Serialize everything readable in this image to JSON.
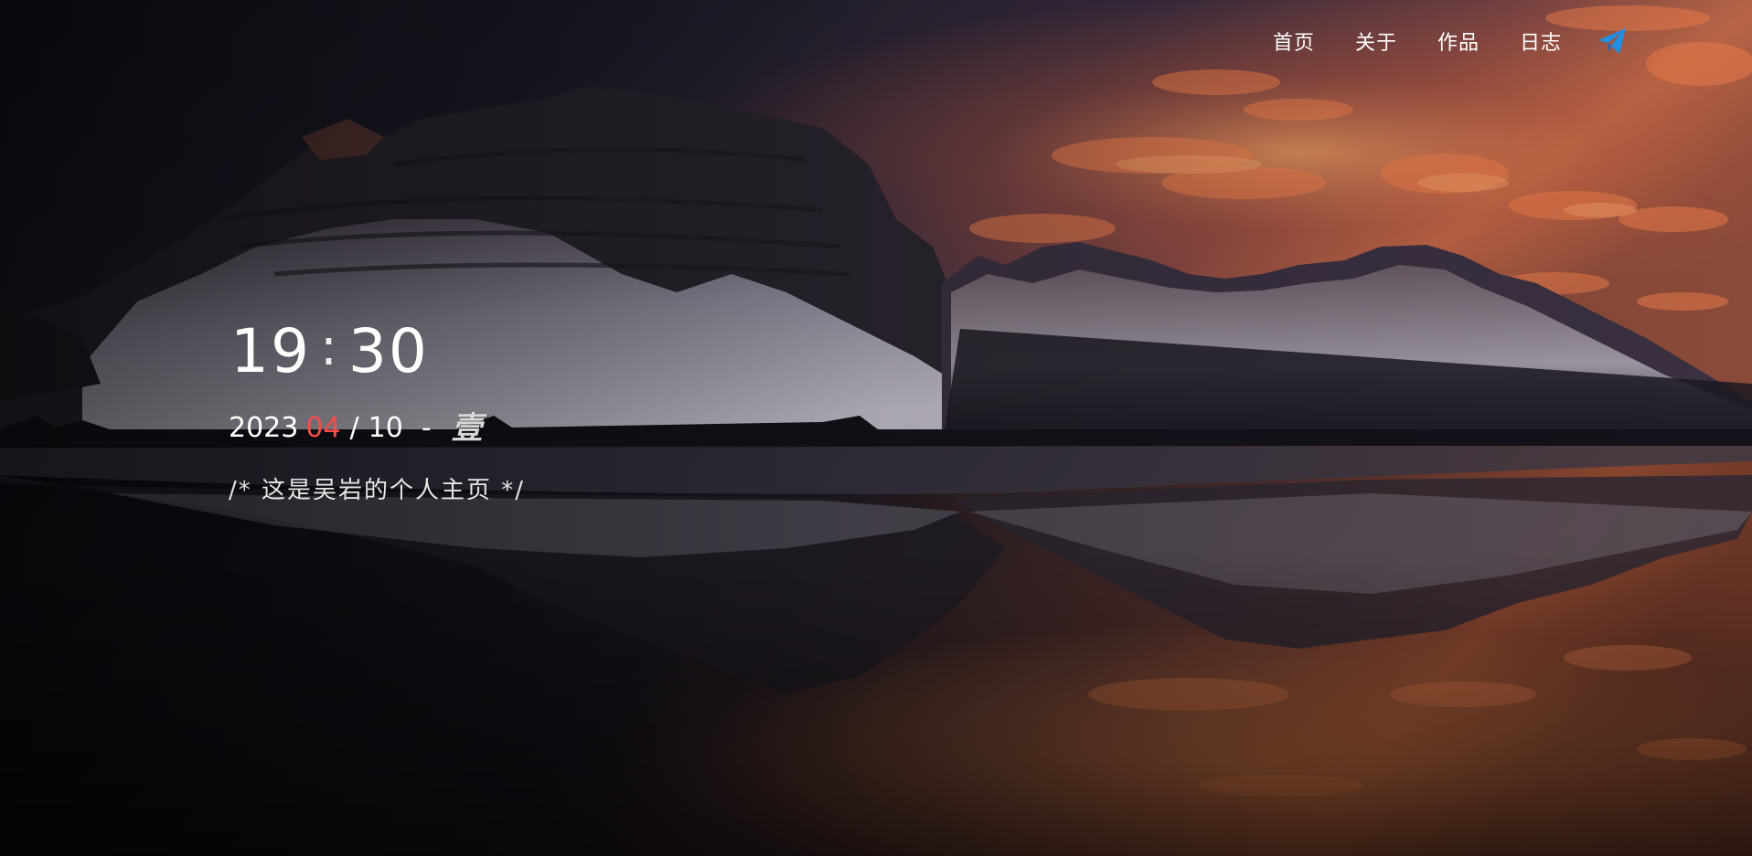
{
  "nav": {
    "items": [
      {
        "label": "首页"
      },
      {
        "label": "关于"
      },
      {
        "label": "作品"
      },
      {
        "label": "日志"
      }
    ],
    "send_icon": "paper-plane-icon",
    "send_icon_color": "#1e8fe6"
  },
  "clock": {
    "hours": "19",
    "separator": ":",
    "minutes": "30"
  },
  "date": {
    "year": "2023",
    "month": "04",
    "slash": "/",
    "day": "10",
    "dash": "-",
    "weekday": "壹",
    "month_color": "#ff4a4a"
  },
  "motto": "/* 这是吴岩的个人主页 */",
  "background": {
    "description_icon": "mountain-lake-sunset-image"
  }
}
